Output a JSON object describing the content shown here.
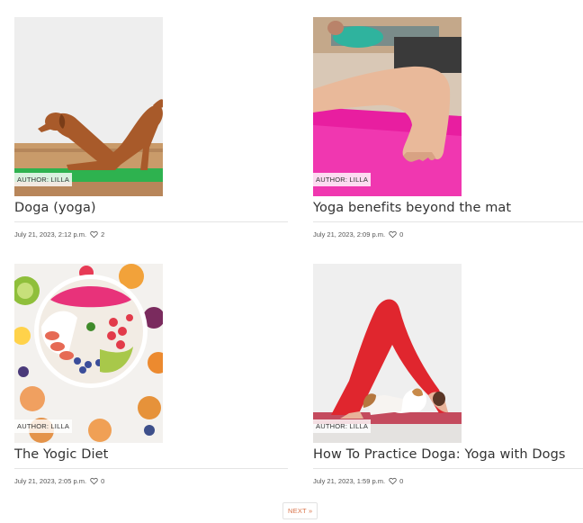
{
  "posts": [
    {
      "title": "Doga (yoga)",
      "author": "AUTHOR: LILLA",
      "date": "July 21, 2023, 2:12 p.m.",
      "likes": "2"
    },
    {
      "title": "Yoga benefits beyond the mat",
      "author": "AUTHOR: LILLA",
      "date": "July 21, 2023, 2:09 p.m.",
      "likes": "0"
    },
    {
      "title": "The Yogic Diet",
      "author": "AUTHOR: LILLA",
      "date": "July 21, 2023, 2:05 p.m.",
      "likes": "0"
    },
    {
      "title": "How To Practice Doga: Yoga with Dogs",
      "author": "AUTHOR: LILLA",
      "date": "July 21, 2023, 1:59 p.m.",
      "likes": "0"
    }
  ],
  "icons": {
    "like": "heart-icon"
  },
  "colors": {
    "accent": "#d9744a",
    "text": "#333333",
    "rule": "#e4e4e4"
  },
  "pagination": {
    "next_label": "NEXT »"
  }
}
